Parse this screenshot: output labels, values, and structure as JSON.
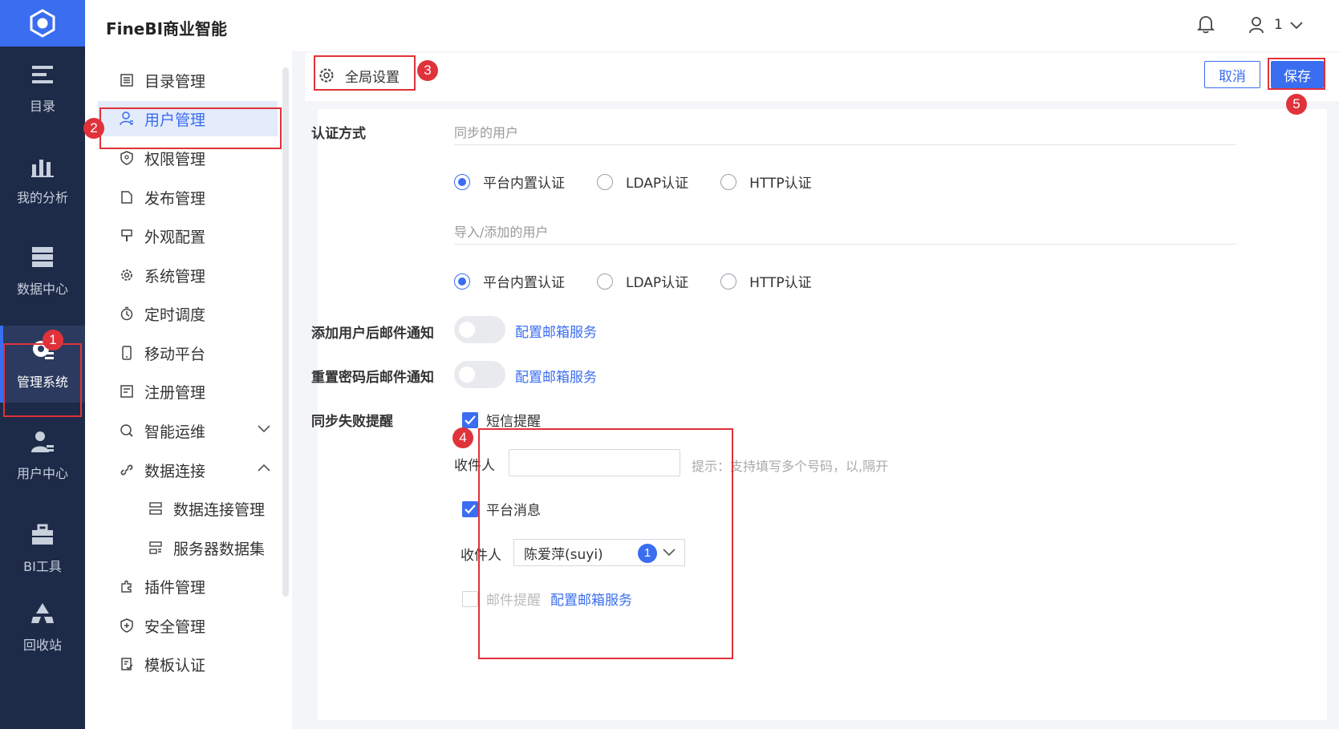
{
  "app": {
    "brand": "FineBI商业智能"
  },
  "header": {
    "user_name": "1"
  },
  "rail": {
    "items": [
      {
        "label": "目录",
        "icon": "catalog-icon"
      },
      {
        "label": "我的分析",
        "icon": "chart-icon"
      },
      {
        "label": "数据中心",
        "icon": "database-icon"
      },
      {
        "label": "管理系统",
        "icon": "gear-icon",
        "active": true
      },
      {
        "label": "用户中心",
        "icon": "user-icon"
      },
      {
        "label": "BI工具",
        "icon": "toolbox-icon"
      },
      {
        "label": "回收站",
        "icon": "recycle-icon"
      }
    ]
  },
  "menu": {
    "items": [
      {
        "label": "目录管理",
        "icon": "list-icon"
      },
      {
        "label": "用户管理",
        "icon": "user-icon",
        "active": true
      },
      {
        "label": "权限管理",
        "icon": "shield-icon"
      },
      {
        "label": "发布管理",
        "icon": "publish-icon"
      },
      {
        "label": "外观配置",
        "icon": "palette-icon"
      },
      {
        "label": "系统管理",
        "icon": "gear-icon"
      },
      {
        "label": "定时调度",
        "icon": "timer-icon"
      },
      {
        "label": "移动平台",
        "icon": "mobile-icon"
      },
      {
        "label": "注册管理",
        "icon": "register-icon"
      },
      {
        "label": "智能运维",
        "icon": "ops-icon",
        "expand": "down"
      },
      {
        "label": "数据连接",
        "icon": "link-icon",
        "expand": "up"
      },
      {
        "label": "数据连接管理",
        "icon": "db-connection-icon",
        "sub": true
      },
      {
        "label": "服务器数据集",
        "icon": "server-dataset-icon",
        "sub": true
      },
      {
        "label": "插件管理",
        "icon": "plugin-icon"
      },
      {
        "label": "安全管理",
        "icon": "security-icon"
      },
      {
        "label": "模板认证",
        "icon": "template-icon"
      }
    ]
  },
  "toolbar": {
    "tab_label": "全局设置",
    "cancel_label": "取消",
    "save_label": "保存"
  },
  "form": {
    "auth_label": "认证方式",
    "synced_users_label": "同步的用户",
    "imported_users_label": "导入/添加的用户",
    "auth_options": [
      "平台内置认证",
      "LDAP认证",
      "HTTP认证"
    ],
    "synced_selected": "平台内置认证",
    "imported_selected": "平台内置认证",
    "add_user_mail_label": "添加用户后邮件通知",
    "reset_pwd_mail_label": "重置密码后邮件通知",
    "config_mail_link": "配置邮箱服务",
    "sync_fail_label": "同步失败提醒",
    "sms_label": "短信提醒",
    "sms_checked": true,
    "recipient_label": "收件人",
    "sms_recipient_value": "",
    "sms_hint": "提示：支持填写多个号码，以,隔开",
    "platform_msg_label": "平台消息",
    "platform_msg_checked": true,
    "platform_recipient_value": "陈爱萍(suyi)",
    "platform_recipient_count": "1",
    "mail_label": "邮件提醒",
    "mail_checked": false
  },
  "annotations": [
    "1",
    "2",
    "3",
    "4",
    "5"
  ],
  "colors": {
    "accent": "#3a6df0",
    "rail": "#1d2a48",
    "annotation": "#e0323a"
  }
}
